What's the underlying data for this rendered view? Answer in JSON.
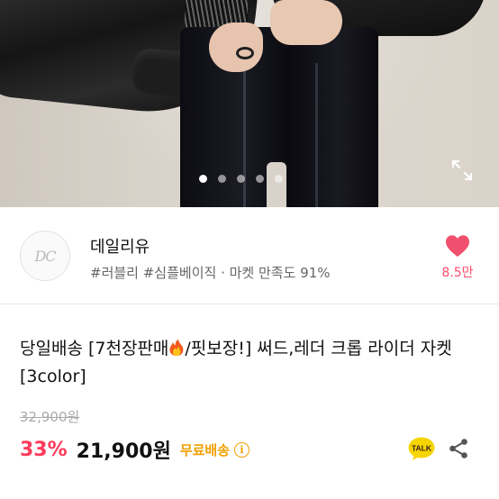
{
  "gallery": {
    "dots": 5,
    "active_dot": 1
  },
  "seller": {
    "logo_text": "DC",
    "name": "데일리유",
    "tags": "#러블리 #심플베이직 · 마켓 만족도 91%",
    "likes": "8.5만"
  },
  "product": {
    "title_part1": "당일배송 [7천장판매",
    "title_part2": "/핏보장!] 써드,레더 크롭 라이더 자켓 [3color]",
    "original_price": "32,900원",
    "discount": "33%",
    "price": "21,900원",
    "shipping": "무료배송",
    "info_glyph": "i"
  },
  "actions": {
    "talk_label": "TALK"
  },
  "colors": {
    "accent_pink": "#ff3b5c",
    "shipping_orange": "#f0a000",
    "heart": "#f0506e",
    "talk_yellow": "#f5d400"
  },
  "icons": {
    "expand": "expand-icon",
    "heart": "heart-icon",
    "info": "info-icon",
    "talk": "kakao-talk-icon",
    "share": "share-icon",
    "fire": "fire-emoji-icon"
  }
}
